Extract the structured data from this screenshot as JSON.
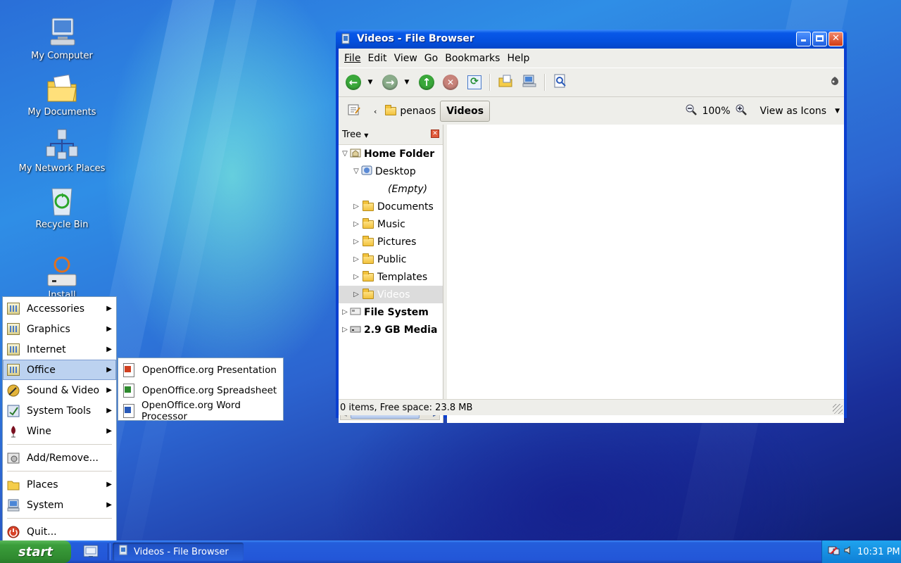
{
  "desktop": {
    "icons": [
      {
        "label": "My Computer"
      },
      {
        "label": "My Documents"
      },
      {
        "label": "My Network Places"
      },
      {
        "label": "Recycle Bin"
      },
      {
        "label": "Install"
      }
    ]
  },
  "window": {
    "title": "Videos - File Browser",
    "menu": [
      "File",
      "Edit",
      "View",
      "Go",
      "Bookmarks",
      "Help"
    ],
    "location": {
      "crumbs": [
        "penaos",
        "Videos"
      ],
      "zoom": "100%",
      "view_mode": "View as Icons"
    },
    "sidebar": {
      "header": "Tree",
      "tree": [
        {
          "label": "Home Folder",
          "level": 0,
          "expanded": true,
          "bold": true
        },
        {
          "label": "Desktop",
          "level": 1,
          "expanded": true
        },
        {
          "label": "(Empty)",
          "level": 2,
          "empty": true
        },
        {
          "label": "Documents",
          "level": 1
        },
        {
          "label": "Music",
          "level": 1
        },
        {
          "label": "Pictures",
          "level": 1
        },
        {
          "label": "Public",
          "level": 1
        },
        {
          "label": "Templates",
          "level": 1
        },
        {
          "label": "Videos",
          "level": 1,
          "selected": true
        },
        {
          "label": "File System",
          "level": 0,
          "bold": true
        },
        {
          "label": "2.9 GB Media",
          "level": 0,
          "bold": true
        }
      ]
    },
    "status": "0 items, Free space: 23.8 MB"
  },
  "start_menu": {
    "items": [
      {
        "label": "Accessories",
        "has_sub": true
      },
      {
        "label": "Graphics",
        "has_sub": true
      },
      {
        "label": "Internet",
        "has_sub": true
      },
      {
        "label": "Office",
        "has_sub": true,
        "highlighted": true
      },
      {
        "label": "Sound & Video",
        "has_sub": true
      },
      {
        "label": "System Tools",
        "has_sub": true
      },
      {
        "label": "Wine",
        "has_sub": true
      },
      {
        "label": "Add/Remove..."
      },
      {
        "label": "Places",
        "has_sub": true
      },
      {
        "label": "System",
        "has_sub": true
      },
      {
        "label": "Quit..."
      }
    ],
    "office_submenu": [
      {
        "label": "OpenOffice.org Presentation",
        "color": "#d04020"
      },
      {
        "label": "OpenOffice.org Spreadsheet",
        "color": "#2e8a2e"
      },
      {
        "label": "OpenOffice.org Word Processor",
        "color": "#2a5ab8"
      }
    ]
  },
  "taskbar": {
    "start_label": "start",
    "task": "Videos - File Browser",
    "clock": "10:31 PM"
  }
}
